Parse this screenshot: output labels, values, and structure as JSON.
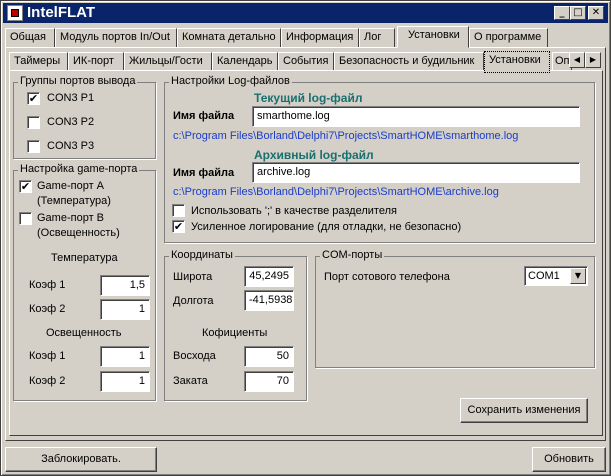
{
  "window": {
    "title": "IntelFLAT",
    "minimize_glyph": "_",
    "maximize_glyph": "□",
    "close_glyph": "✕"
  },
  "top_tabs": [
    {
      "label": "Общая"
    },
    {
      "label": "Модуль портов In/Out"
    },
    {
      "label": "Комната детально"
    },
    {
      "label": "Информация"
    },
    {
      "label": "Лог"
    },
    {
      "label": "Установки"
    },
    {
      "label": "О программе"
    }
  ],
  "sub_tabs": [
    {
      "label": "Таймеры"
    },
    {
      "label": "ИК-порт"
    },
    {
      "label": "Жильцы/Гости"
    },
    {
      "label": "Календарь"
    },
    {
      "label": "События"
    },
    {
      "label": "Безопасность и будильник"
    },
    {
      "label": "Установки"
    },
    {
      "label": "Оп"
    }
  ],
  "scroll_left_glyph": "◀",
  "scroll_right_glyph": "▶",
  "output_ports": {
    "title": "Группы портов вывода",
    "items": [
      {
        "label": "CON3 P1",
        "checked": true,
        "mark": "✔"
      },
      {
        "label": "CON3 P2",
        "checked": false,
        "mark": ""
      },
      {
        "label": "CON3 P3",
        "checked": false,
        "mark": ""
      }
    ]
  },
  "game_port": {
    "title": "Настройка game-порта",
    "port_a": {
      "line1": "Game-порт A",
      "line2": "(Температура)",
      "checked": true,
      "mark": "✔"
    },
    "port_b": {
      "line1": "Game-порт B",
      "line2": "(Освещенность)",
      "checked": false,
      "mark": ""
    },
    "temperature_label": "Температура",
    "temp_k1_label": "Коэф 1",
    "temp_k1_value": "1,5",
    "temp_k2_label": "Коэф 2",
    "temp_k2_value": "1",
    "light_label": "Освещенность",
    "light_k1_label": "Коэф 1",
    "light_k1_value": "1",
    "light_k2_label": "Коэф 2",
    "light_k2_value": "1"
  },
  "log_settings": {
    "title": "Настройки Log-файлов",
    "current_header": "Текущий log-файл",
    "filename_label": "Имя файла",
    "current_file": "smarthome.log",
    "current_path": "c:\\Program Files\\Borland\\Delphi7\\Projects\\SmartHOME\\smarthome.log",
    "archive_header": "Архивный log-файл",
    "archive_filename_label": "Имя файла",
    "archive_file": "archive.log",
    "archive_path": "c:\\Program Files\\Borland\\Delphi7\\Projects\\SmartHOME\\archive.log",
    "use_separator": {
      "label": "Использовать ';' в качестве разделителя",
      "checked": false,
      "mark": ""
    },
    "verbose": {
      "label": "Усиленное логирование (для отладки, не безопасно)",
      "checked": true,
      "mark": "✔"
    }
  },
  "coordinates": {
    "title": "Координаты",
    "latitude_label": "Широта",
    "latitude_value": "45,2495",
    "longitude_label": "Долгота",
    "longitude_value": "-41,5938",
    "coef_header": "Кофициенты",
    "sunrise_label": "Восхода",
    "sunrise_value": "50",
    "sunset_label": "Заката",
    "sunset_value": "70"
  },
  "com_ports": {
    "title": "COM-порты",
    "phone_port_label": "Порт сотового телефона",
    "phone_port_value": "COM1",
    "dropdown_glyph": "▼"
  },
  "buttons": {
    "save": "Сохранить изменения",
    "lock": "Заблокировать.",
    "refresh": "Обновить"
  }
}
